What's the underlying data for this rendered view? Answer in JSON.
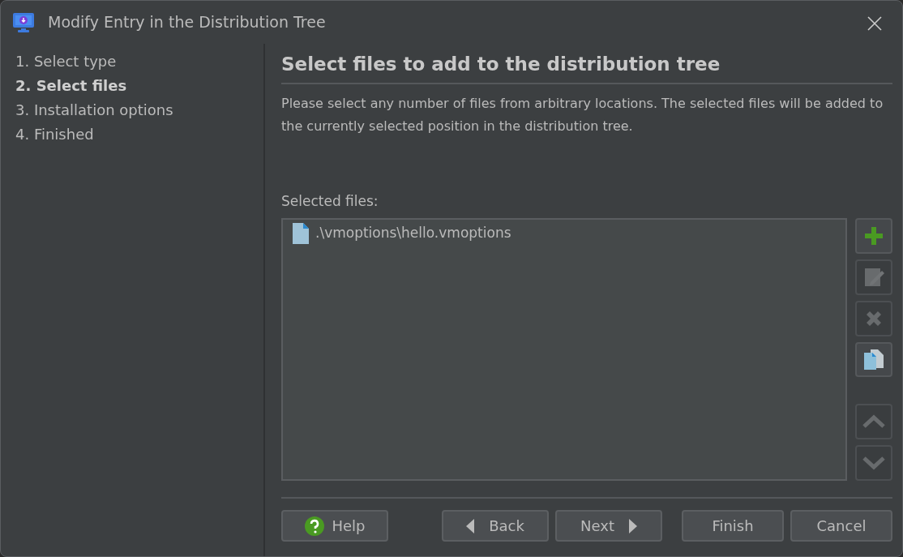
{
  "window": {
    "title": "Modify Entry in the Distribution Tree"
  },
  "steps": [
    {
      "label": "1. Select type",
      "selected": false
    },
    {
      "label": "2. Select files",
      "selected": true
    },
    {
      "label": "3. Installation options",
      "selected": false
    },
    {
      "label": "4. Finished",
      "selected": false
    }
  ],
  "heading": "Select files to add to the distribution tree",
  "description": "Please select any number of files from arbitrary locations. The selected files will be added to the currently selected position in the distribution tree.",
  "files_label": "Selected files:",
  "files": [
    {
      "name": ".\\vmoptions\\hello.vmoptions"
    }
  ],
  "tools": [
    {
      "kind": "add",
      "disabled": false
    },
    {
      "kind": "edit",
      "disabled": true
    },
    {
      "kind": "delete",
      "disabled": true
    },
    {
      "kind": "copy",
      "disabled": false
    },
    {
      "kind": "up",
      "disabled": true
    },
    {
      "kind": "down",
      "disabled": true
    }
  ],
  "buttons": [
    {
      "kind": "help",
      "label": "Help"
    },
    {
      "kind": "back",
      "label": "Back"
    },
    {
      "kind": "next",
      "label": "Next"
    },
    {
      "kind": "finish",
      "label": "Finish"
    },
    {
      "kind": "cancel",
      "label": "Cancel"
    }
  ]
}
